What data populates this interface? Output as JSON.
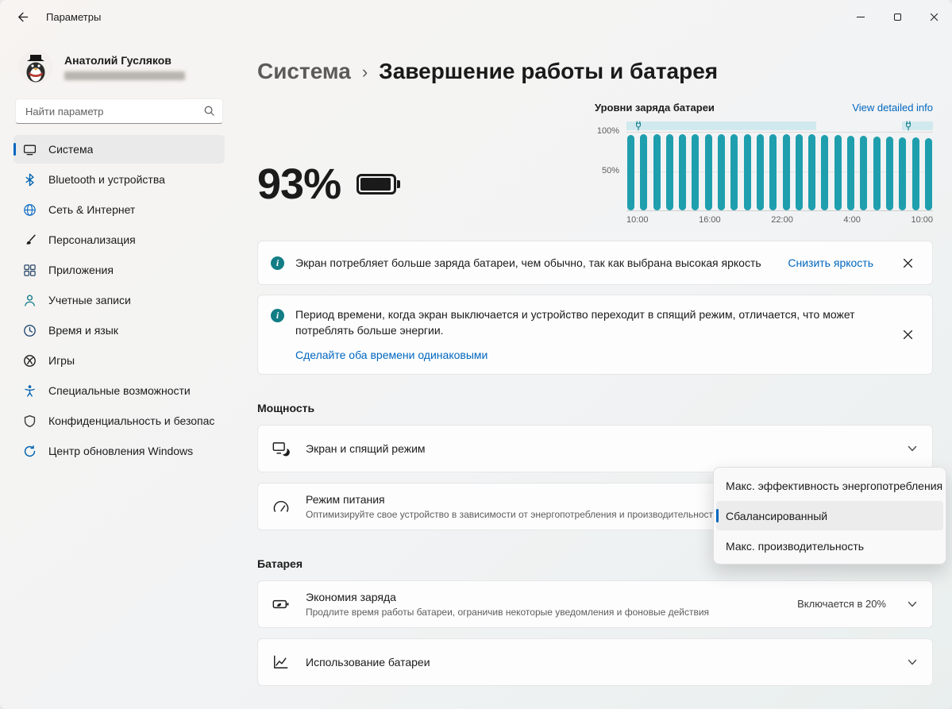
{
  "window": {
    "title": "Параметры"
  },
  "icons": {
    "titlebar": [
      "back-arrow",
      "minimize",
      "maximize",
      "close"
    ],
    "sidebar": [
      "system",
      "bluetooth",
      "network",
      "personalization",
      "apps",
      "accounts",
      "time-language",
      "games",
      "accessibility",
      "privacy",
      "windows-update"
    ],
    "misc": [
      "search",
      "battery-full",
      "info-circle",
      "dismiss-x",
      "chevron-down",
      "power-plug",
      "screen-sleep",
      "power-mode",
      "battery-saver",
      "battery-usage"
    ]
  },
  "colors": {
    "accent": "#0067c0",
    "link": "#0067c0",
    "info_icon": "#127d85",
    "chart_bar": "#1f9fae",
    "charging_band": "#d0e9ee"
  },
  "sidebar": {
    "user_name": "Анатолий Гусляков",
    "user_subtitle_redacted": true,
    "search_placeholder": "Найти параметр",
    "items": [
      {
        "label": "Система",
        "selected": true
      },
      {
        "label": "Bluetooth и устройства",
        "selected": false
      },
      {
        "label": "Сеть & Интернет",
        "selected": false
      },
      {
        "label": "Персонализация",
        "selected": false
      },
      {
        "label": "Приложения",
        "selected": false
      },
      {
        "label": "Учетные записи",
        "selected": false
      },
      {
        "label": "Время и язык",
        "selected": false
      },
      {
        "label": "Игры",
        "selected": false
      },
      {
        "label": "Специальные возможности",
        "selected": false
      },
      {
        "label": "Конфиденциальность и безопасность",
        "selected": false
      },
      {
        "label": "Центр обновления Windows",
        "selected": false
      }
    ]
  },
  "main": {
    "breadcrumb": {
      "parent": "Система",
      "sep": "›",
      "current": "Завершение работы и батарея"
    },
    "battery_percent": "93%",
    "banners": [
      {
        "text": "Экран потребляет больше заряда батареи, чем обычно, так как выбрана высокая яркость",
        "action": "Снизить яркость"
      },
      {
        "text": "Период времени, когда экран выключается и устройство переходит в спящий режим, отличается, что может потреблять больше энергии.",
        "action": "Сделайте оба времени одинаковыми"
      }
    ],
    "power_section": {
      "heading": "Мощность",
      "cards": [
        {
          "title": "Экран и спящий режим"
        },
        {
          "title": "Режим питания",
          "subtitle": "Оптимизируйте свое устройство в зависимости от энергопотребления и производительности"
        }
      ]
    },
    "battery_section": {
      "heading": "Батарея",
      "cards": [
        {
          "title": "Экономия заряда",
          "subtitle": "Продлите время работы батареи, ограничив некоторые уведомления и фоновые действия",
          "value": "Включается в 20%"
        },
        {
          "title": "Использование батареи"
        }
      ]
    },
    "power_mode_dropdown": {
      "options": [
        "Макс. эффективность энергопотребления",
        "Сбалансированный",
        "Макс. производительность"
      ],
      "selected": "Сбалансированный",
      "selected_index": 1
    }
  },
  "chart_data": {
    "type": "bar",
    "title": "Уровни заряда батареи",
    "link_label": "View detailed info",
    "y_ticks": [
      "100%",
      "50%"
    ],
    "x_ticks": [
      "10:00",
      "16:00",
      "22:00",
      "4:00",
      "10:00"
    ],
    "ylim": [
      0,
      100
    ],
    "unit": "%",
    "values": [
      97,
      98,
      98,
      98,
      98,
      98,
      98,
      98,
      98,
      98,
      98,
      98,
      98,
      98,
      98,
      97,
      97,
      96,
      96,
      95,
      95,
      94,
      94,
      93
    ],
    "charging_periods_fraction": [
      [
        0,
        0.62
      ],
      [
        0.9,
        1.0
      ]
    ],
    "plug_marker_positions_fraction": [
      0.04,
      0.92
    ],
    "bar_color": "#1f9fae",
    "band_color": "#d0e9ee"
  }
}
